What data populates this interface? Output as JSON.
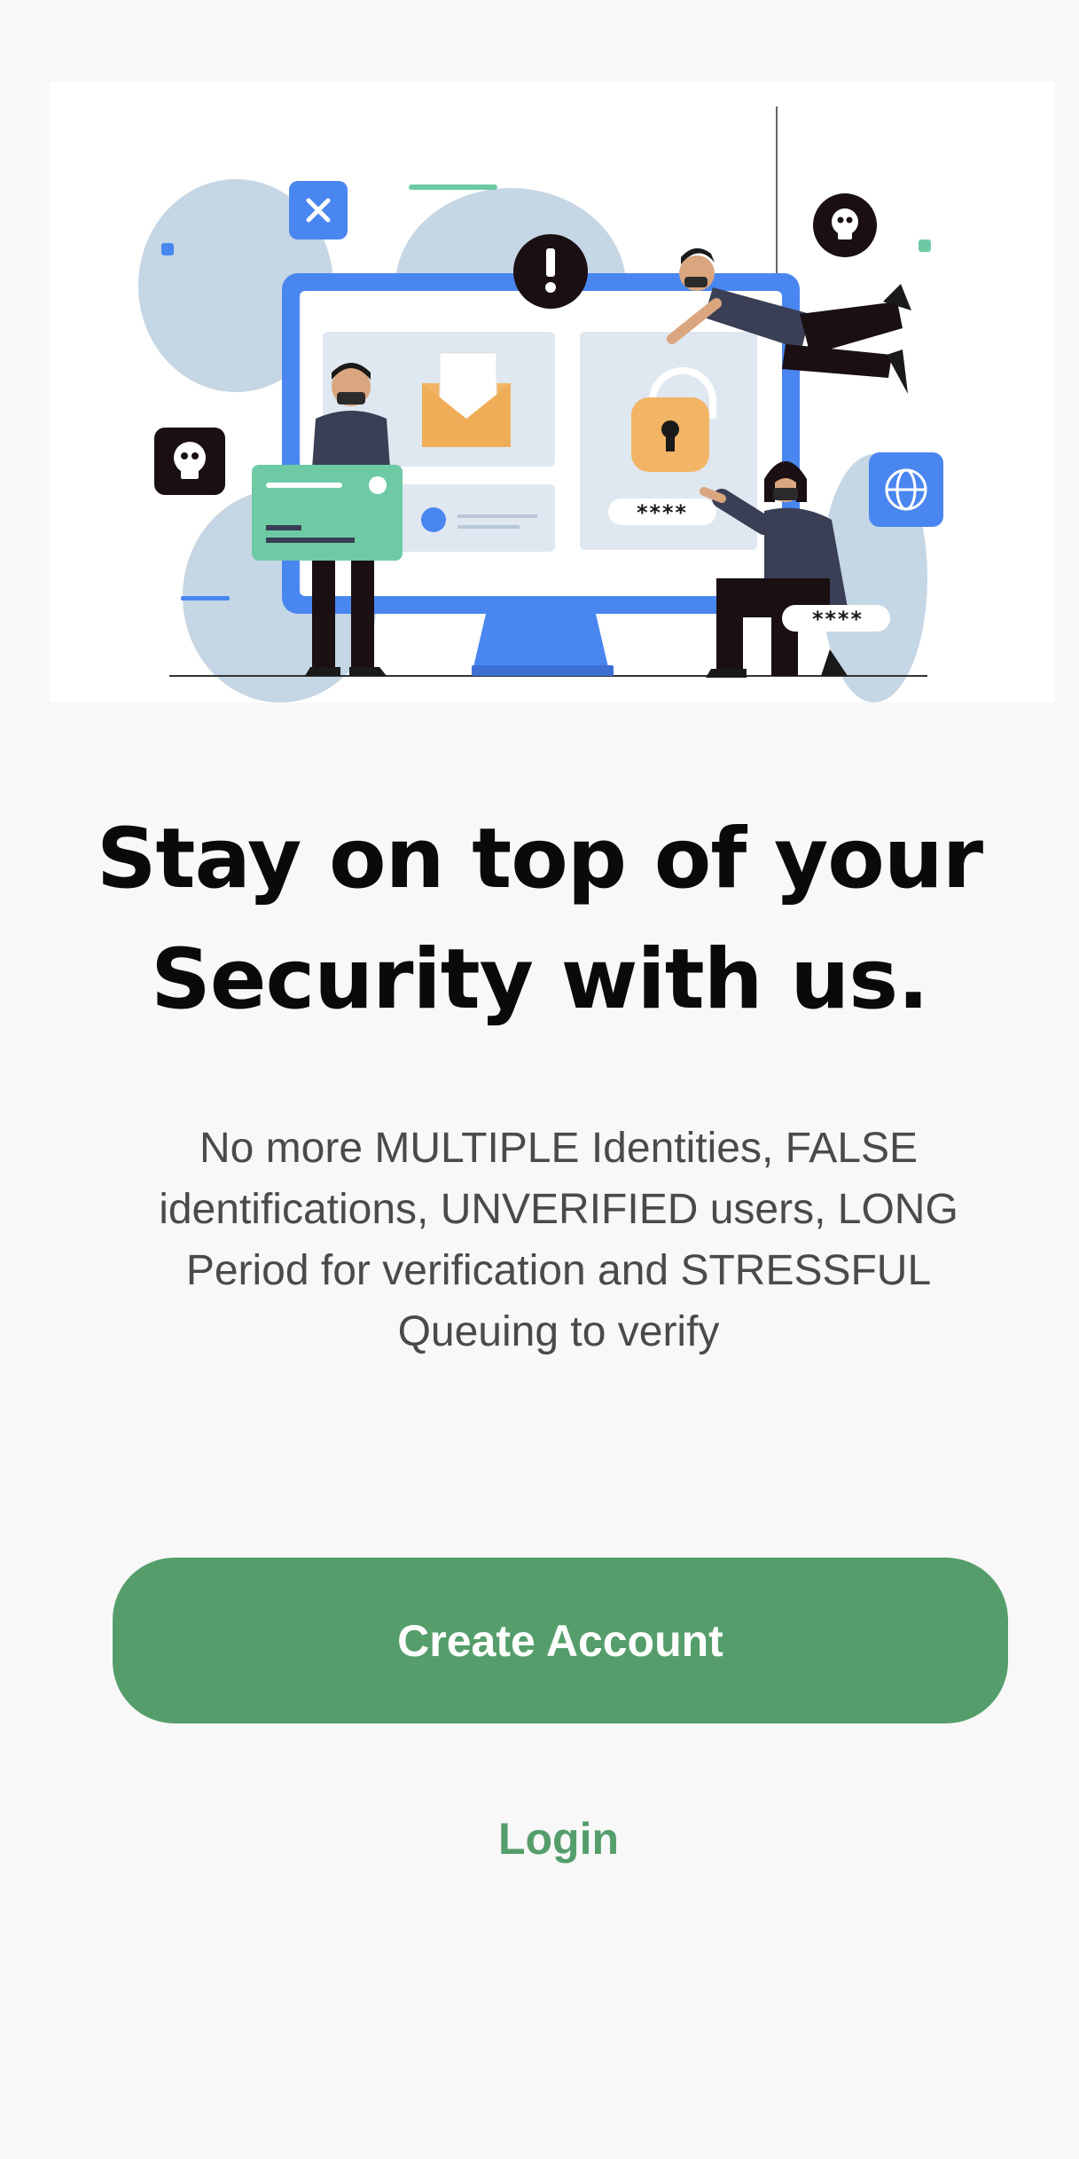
{
  "illustration": {
    "password_mask_1": "****",
    "password_mask_2": "****"
  },
  "headline": {
    "line1": "Stay on top of your",
    "line2": "Security with us."
  },
  "description": "No more MULTIPLE Identities, FALSE identifications, UNVERIFIED users, LONG Period for verification and STRESSFUL Queuing to verify",
  "actions": {
    "create_account_label": "Create Account",
    "login_label": "Login"
  },
  "colors": {
    "primary_green": "#559e6b",
    "accent_blue": "#4a86f0",
    "background": "#f8f8f8"
  }
}
